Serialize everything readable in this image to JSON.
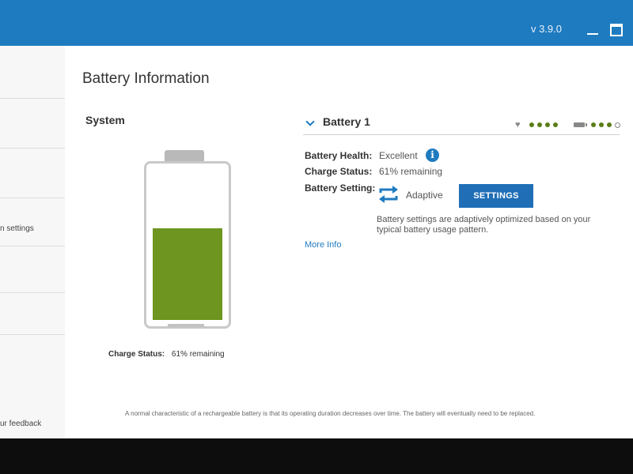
{
  "window": {
    "version": "v 3.9.0"
  },
  "sidebar": {
    "items": [
      {
        "label": ""
      },
      {
        "label": ""
      },
      {
        "label": ""
      },
      {
        "label": "n settings"
      },
      {
        "label": ""
      },
      {
        "label": ""
      }
    ],
    "feedback_label": "ur feedback"
  },
  "page": {
    "title": "Battery Information",
    "system_label": "System"
  },
  "battery_graphic": {
    "charge_fraction": 0.61,
    "fill_color": "#6d951f"
  },
  "charge_bottom": {
    "label": "Charge Status:",
    "value": "61% remaining"
  },
  "battery1": {
    "title": "Battery 1",
    "health_label": "Battery Health:",
    "health_value": "Excellent",
    "charge_label": "Charge Status:",
    "charge_value": "61% remaining",
    "setting_label": "Battery Setting:",
    "setting_value": "Adaptive",
    "settings_button": "SETTINGS",
    "description": "Battery settings are adaptively optimized based on your typical battery usage pattern.",
    "more_info": "More Info",
    "health_dots": 4,
    "charge_dots_filled": 3,
    "charge_dots_total": 4
  },
  "footnote": "A normal characteristic of a rechargeable battery is that its operating duration decreases over time. The battery will eventually need to be replaced.",
  "colors": {
    "accent": "#1f7bc0",
    "green": "#6d951f"
  }
}
